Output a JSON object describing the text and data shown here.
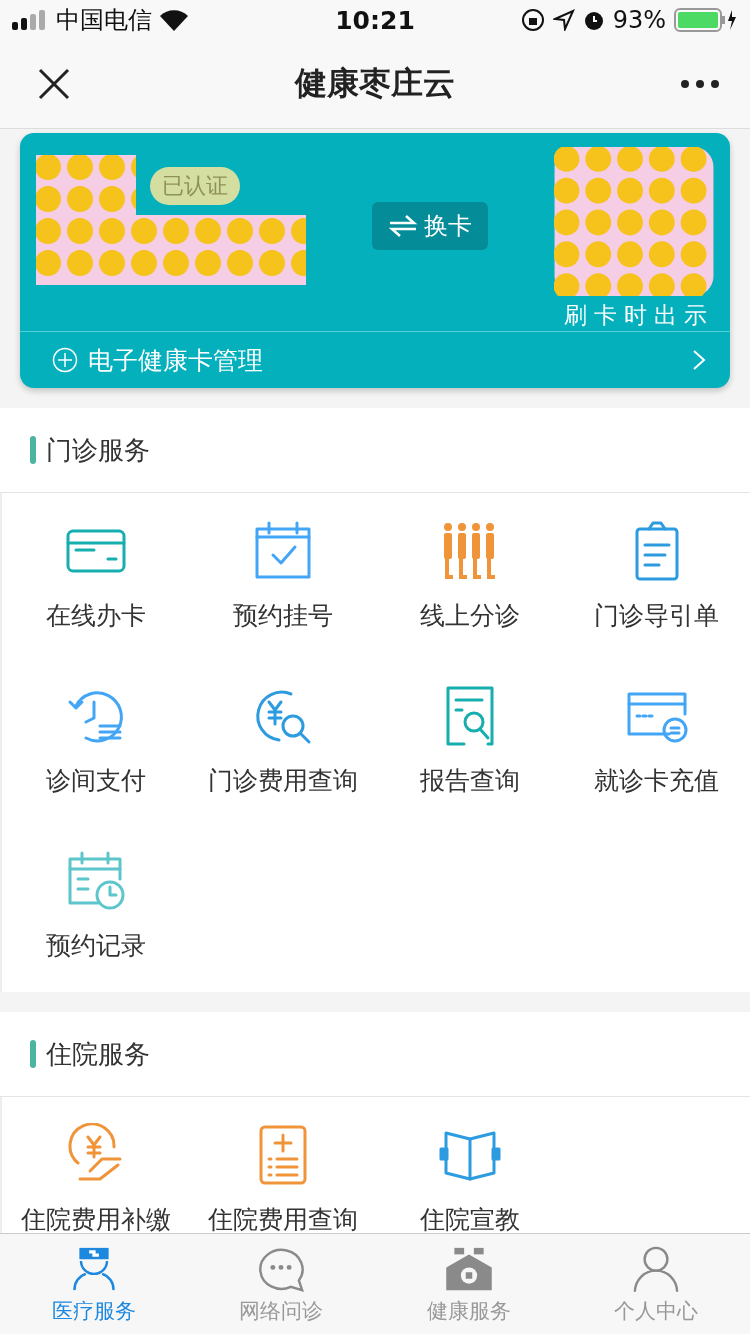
{
  "status_bar": {
    "carrier": "中国电信",
    "time": "10:21",
    "battery": "93%"
  },
  "nav": {
    "title": "健康枣庄云"
  },
  "health_card": {
    "badge": "已认证",
    "switch_button": "换卡",
    "hint": "刷卡时出示",
    "manage": "电子健康卡管理"
  },
  "sections": [
    {
      "title": "门诊服务",
      "items": [
        {
          "label": "在线办卡"
        },
        {
          "label": "预约挂号"
        },
        {
          "label": "线上分诊"
        },
        {
          "label": "门诊导引单"
        },
        {
          "label": "诊间支付"
        },
        {
          "label": "门诊费用查询"
        },
        {
          "label": "报告查询"
        },
        {
          "label": "就诊卡充值"
        },
        {
          "label": "预约记录"
        }
      ]
    },
    {
      "title": "住院服务",
      "items": [
        {
          "label": "住院费用补缴"
        },
        {
          "label": "住院费用查询"
        },
        {
          "label": "住院宣教"
        }
      ]
    }
  ],
  "tab_bar": [
    {
      "label": "医疗服务",
      "selected": true
    },
    {
      "label": "网络问诊",
      "selected": false
    },
    {
      "label": "健康服务",
      "selected": false
    },
    {
      "label": "个人中心",
      "selected": false
    }
  ]
}
